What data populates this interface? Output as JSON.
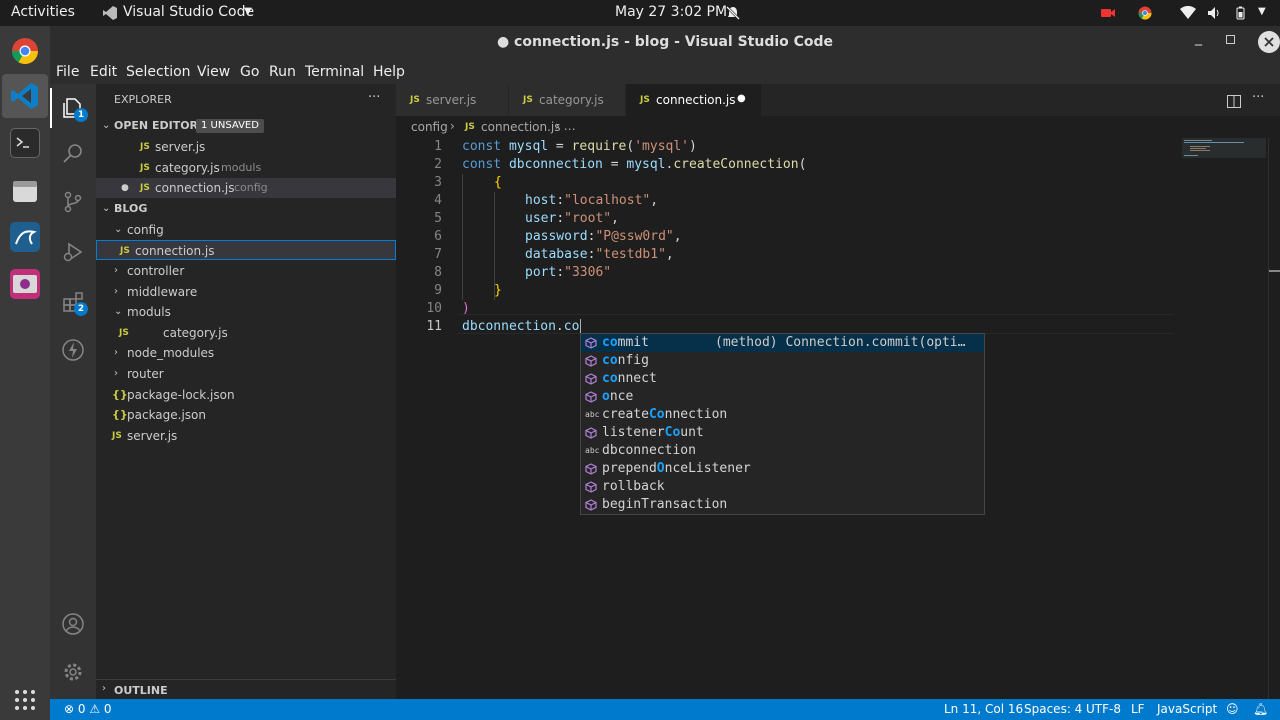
{
  "gnome": {
    "activities": "Activities",
    "app_name": "Visual Studio Code",
    "clock": "May 27  3:02 PM"
  },
  "window": {
    "title": "● connection.js - blog - Visual Studio Code"
  },
  "menu": [
    "File",
    "Edit",
    "Selection",
    "View",
    "Go",
    "Run",
    "Terminal",
    "Help"
  ],
  "activity": {
    "explorer_badge": "1",
    "extensions_badge": "2"
  },
  "sidebar": {
    "title": "EXPLORER",
    "more": "···",
    "open_editors": {
      "label": "OPEN EDITORS",
      "badge": "1 UNSAVED",
      "items": [
        {
          "icon": "JS",
          "name": "server.js",
          "desc": ""
        },
        {
          "icon": "JS",
          "name": "category.js",
          "desc": "moduls"
        },
        {
          "icon": "JS",
          "name": "connection.js",
          "desc": "config"
        }
      ]
    },
    "project": {
      "label": "BLOG",
      "tree": [
        {
          "name": "config"
        },
        {
          "name": "connection.js"
        },
        {
          "name": "controller"
        },
        {
          "name": "middleware"
        },
        {
          "name": "moduls"
        },
        {
          "name": "category.js"
        },
        {
          "name": "node_modules"
        },
        {
          "name": "router"
        },
        {
          "name": "package-lock.json"
        },
        {
          "name": "package.json"
        },
        {
          "name": "server.js"
        }
      ]
    },
    "outline": "OUTLINE"
  },
  "tabs": [
    {
      "icon": "JS",
      "label": "server.js"
    },
    {
      "icon": "JS",
      "label": "category.js"
    },
    {
      "icon": "JS",
      "label": "connection.js",
      "dirty": "●"
    }
  ],
  "breadcrumb": {
    "folder": "config",
    "sep1": "›",
    "file": "connection.js",
    "sep2": "› …"
  },
  "editor": {
    "line_numbers": [
      "1",
      "2",
      "3",
      "4",
      "5",
      "6",
      "7",
      "8",
      "9",
      "10",
      "11"
    ]
  },
  "code": {
    "l1": {
      "kw": "const",
      "var": "mysql",
      "eq": " = ",
      "fn": "require",
      "p1": "(",
      "str": "'mysql'",
      "p2": ")"
    },
    "l2": {
      "kw": "const",
      "var": "dbconnection",
      "eq": " = ",
      "obj": "mysql",
      "dot": ".",
      "fn": "createConnection",
      "p1": "("
    },
    "l3": "{",
    "l4": {
      "key": "host",
      "colon": ":",
      "val": "\"localhost\"",
      "comma": ","
    },
    "l5": {
      "key": "user",
      "colon": ":",
      "val": "\"root\"",
      "comma": ","
    },
    "l6": {
      "key": "password",
      "colon": ":",
      "val": "\"P@ssw0rd\"",
      "comma": ","
    },
    "l7": {
      "key": "database",
      "colon": ":",
      "val": "\"testdb1\"",
      "comma": ","
    },
    "l8": {
      "key": "port",
      "colon": ":",
      "val": "\"3306\""
    },
    "l9": "}",
    "l10": ")",
    "l11": {
      "obj": "dbconnection",
      "dot": ".",
      "typed": "co"
    }
  },
  "suggestions": {
    "detail": "(method) Connection.commit(opti…",
    "items": [
      {
        "kind": "method",
        "match": "co",
        "rest": "mmit"
      },
      {
        "kind": "method",
        "match": "co",
        "rest": "nfig"
      },
      {
        "kind": "method",
        "match": "co",
        "rest": "nnect"
      },
      {
        "kind": "method",
        "match": "o",
        "rest": "nce"
      },
      {
        "kind": "text",
        "pre": "create",
        "match": "Co",
        "rest": "nnection"
      },
      {
        "kind": "method",
        "pre": "listener",
        "match": "Co",
        "rest": "unt"
      },
      {
        "kind": "text",
        "pre": "dbconnection",
        "match": "",
        "rest": ""
      },
      {
        "kind": "method",
        "pre": "prepend",
        "match": "O",
        "rest": "nceListener"
      },
      {
        "kind": "method",
        "pre": "rollback",
        "match": "",
        "rest": ""
      },
      {
        "kind": "method",
        "pre": "beginTransaction",
        "match": "",
        "rest": ""
      }
    ]
  },
  "status": {
    "problems": "⊗ 0 ⚠ 0",
    "position": "Ln 11, Col 16",
    "spaces": "Spaces: 4",
    "encoding": "UTF-8",
    "eol": "LF",
    "language": "JavaScript"
  },
  "colors": {
    "accent": "#007acc",
    "keyword": "#569cd6",
    "variable": "#9cdcfe",
    "function": "#dcdcaa",
    "string": "#ce9178",
    "js_icon": "#cbcb41",
    "suggest_highlight": "#18a3ff"
  }
}
